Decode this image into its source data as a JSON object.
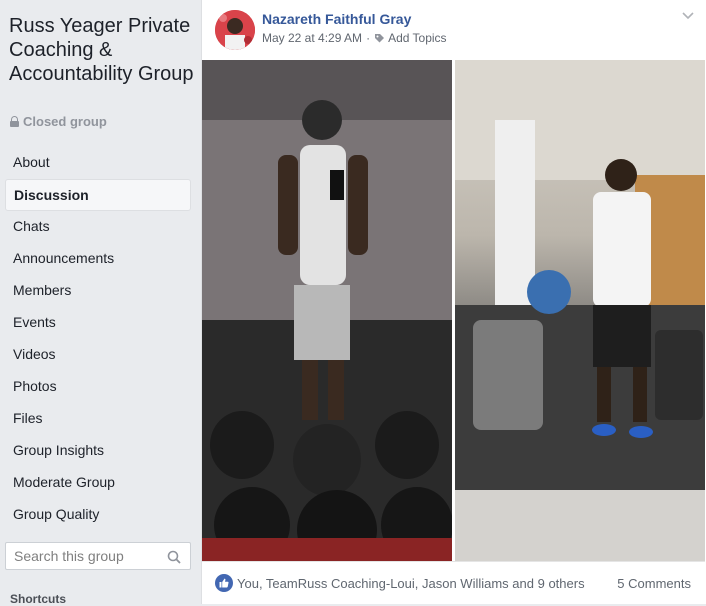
{
  "group": {
    "title": "Russ Yeager Private Coaching & Accountability Group",
    "privacy": "Closed group"
  },
  "nav": {
    "items": [
      {
        "label": "About",
        "active": false
      },
      {
        "label": "Discussion",
        "active": true
      },
      {
        "label": "Chats",
        "active": false
      },
      {
        "label": "Announcements",
        "active": false
      },
      {
        "label": "Members",
        "active": false
      },
      {
        "label": "Events",
        "active": false
      },
      {
        "label": "Videos",
        "active": false
      },
      {
        "label": "Photos",
        "active": false
      },
      {
        "label": "Files",
        "active": false
      },
      {
        "label": "Group Insights",
        "active": false
      },
      {
        "label": "Moderate Group",
        "active": false
      },
      {
        "label": "Group Quality",
        "active": false
      }
    ]
  },
  "search": {
    "placeholder": "Search this group"
  },
  "shortcuts": {
    "label": "Shortcuts"
  },
  "post": {
    "author": "Nazareth Faithful Gray",
    "timestamp": "May 22 at 4:29 AM",
    "separator": "·",
    "add_topics": "Add Topics",
    "reactions_text": "You, TeamRuss Coaching-Loui, Jason Williams and 9 others",
    "comments_text": "5 Comments"
  },
  "colors": {
    "link": "#365899",
    "like": "#4267b2",
    "background": "#e9ebee"
  }
}
